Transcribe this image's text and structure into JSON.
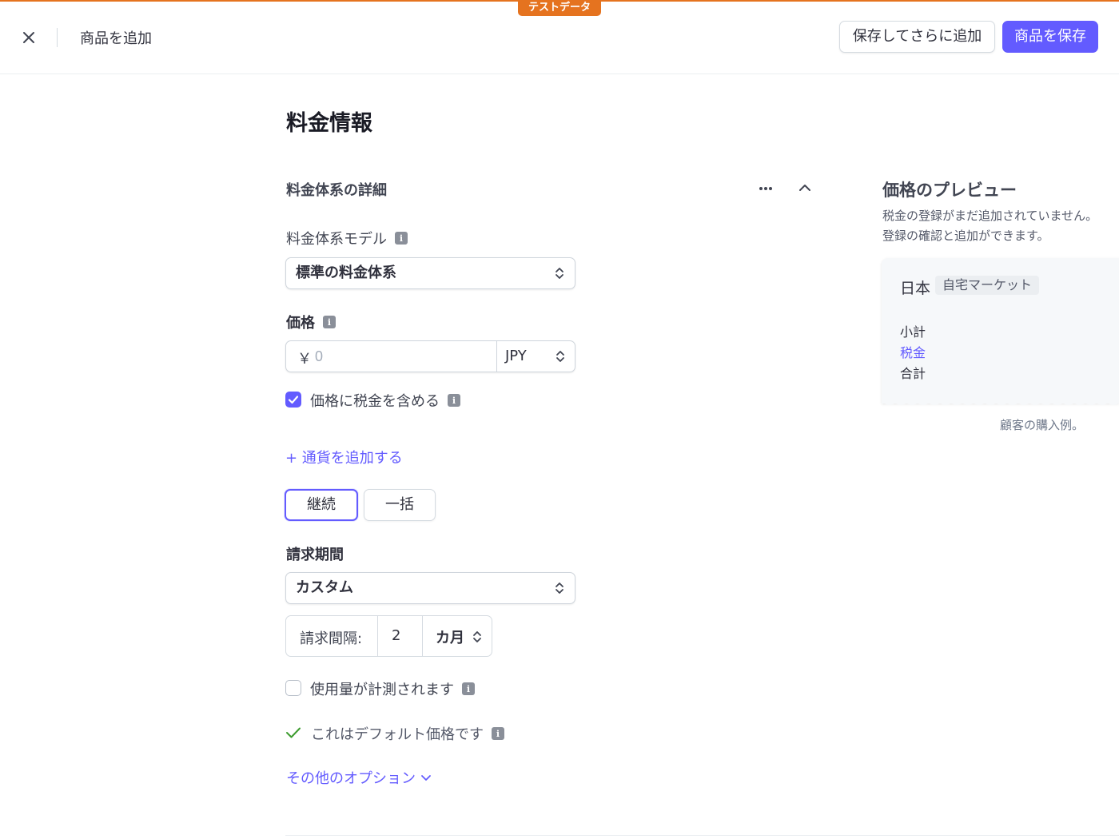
{
  "header": {
    "test_badge": "テストデータ",
    "title": "商品を追加",
    "save_add_more": "保存してさらに追加",
    "save_product": "商品を保存"
  },
  "section": {
    "title": "料金情報",
    "subsection": "料金体系の詳細"
  },
  "pricing_model": {
    "label": "料金体系モデル",
    "value": "標準の料金体系"
  },
  "price": {
    "label": "価格",
    "symbol": "￥",
    "placeholder": "0",
    "currency": "JPY"
  },
  "tax_inclusive": {
    "label": "価格に税金を含める",
    "checked": true
  },
  "add_currency": "+ 通貨を追加する",
  "billing_type": {
    "options": [
      "継続",
      "一括"
    ],
    "selected": "継続"
  },
  "billing_period": {
    "label": "請求期間",
    "value": "カスタム"
  },
  "billing_interval": {
    "label": "請求間隔:",
    "count": "2",
    "unit": "カ月"
  },
  "metered": {
    "label": "使用量が計測されます",
    "checked": false
  },
  "default_price": {
    "label": "これはデフォルト価格です"
  },
  "more_options": "その他のオプション",
  "preview": {
    "title": "価格のプレビュー",
    "desc_line1": "税金の登録がまだ追加されていません。",
    "desc_line2": "登録の確認と追加ができます。",
    "country": "日本",
    "market_badge": "自宅マーケット",
    "rows": [
      "小計",
      "税金",
      "合計"
    ],
    "caption": "顧客の購入例。"
  },
  "colors": {
    "accent": "#635bff",
    "test_badge": "#e5731f",
    "check_green": "#3d9c2f"
  }
}
